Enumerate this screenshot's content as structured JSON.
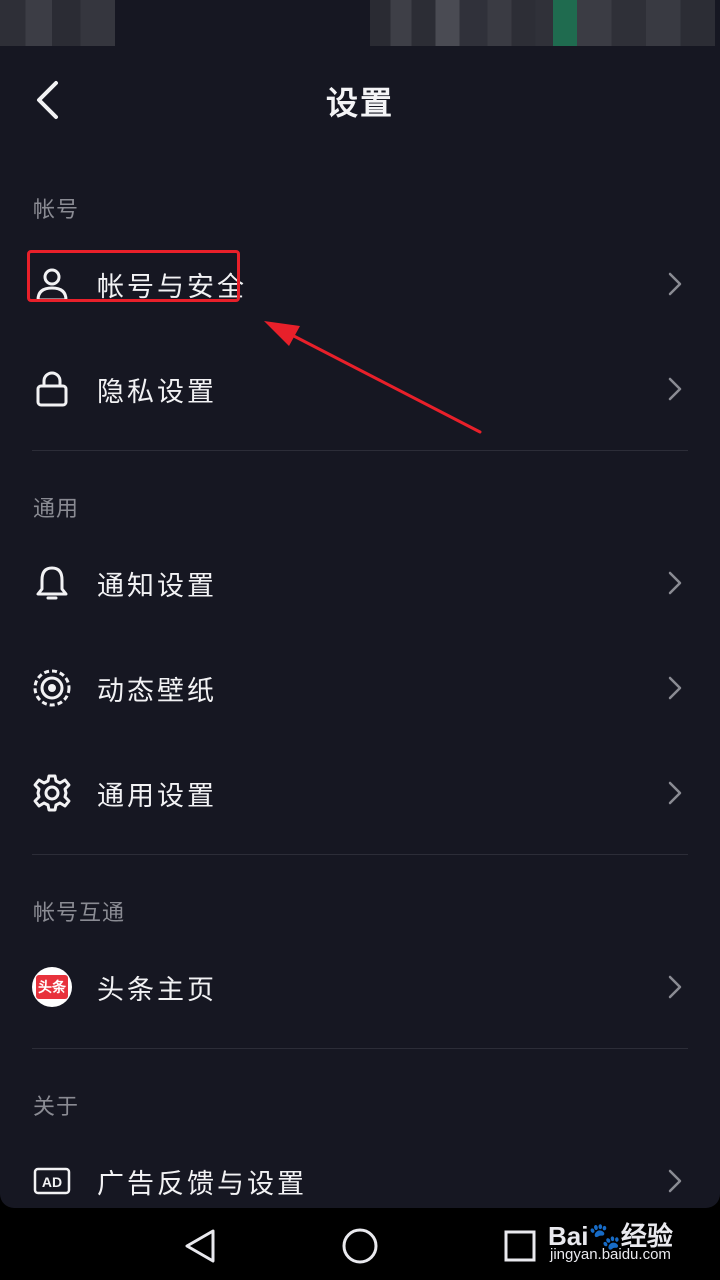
{
  "header": {
    "title": "设置"
  },
  "sections": [
    {
      "title": "帐号",
      "items": [
        {
          "label": "帐号与安全",
          "icon": "user-icon"
        },
        {
          "label": "隐私设置",
          "icon": "lock-icon"
        }
      ]
    },
    {
      "title": "通用",
      "items": [
        {
          "label": "通知设置",
          "icon": "bell-icon"
        },
        {
          "label": "动态壁纸",
          "icon": "wallpaper-icon"
        },
        {
          "label": "通用设置",
          "icon": "gear-icon"
        }
      ]
    },
    {
      "title": "帐号互通",
      "items": [
        {
          "label": "头条主页",
          "icon": "toutiao-icon",
          "badge": "头条"
        }
      ]
    },
    {
      "title": "关于",
      "items": [
        {
          "label": "广告反馈与设置",
          "icon": "ad-icon",
          "badge": "AD"
        }
      ]
    }
  ],
  "navbar": {
    "back": "back-triangle-icon",
    "home": "home-circle-icon",
    "recents": "recents-square-icon"
  },
  "watermark": {
    "brand": "Bai🐾经验",
    "url": "jingyan.baidu.com"
  },
  "colors": {
    "background": "#161722",
    "text": "#f2f2f4",
    "section_header": "#8a8b93",
    "divider": "#2c2d38",
    "annotation": "#e8202a"
  }
}
